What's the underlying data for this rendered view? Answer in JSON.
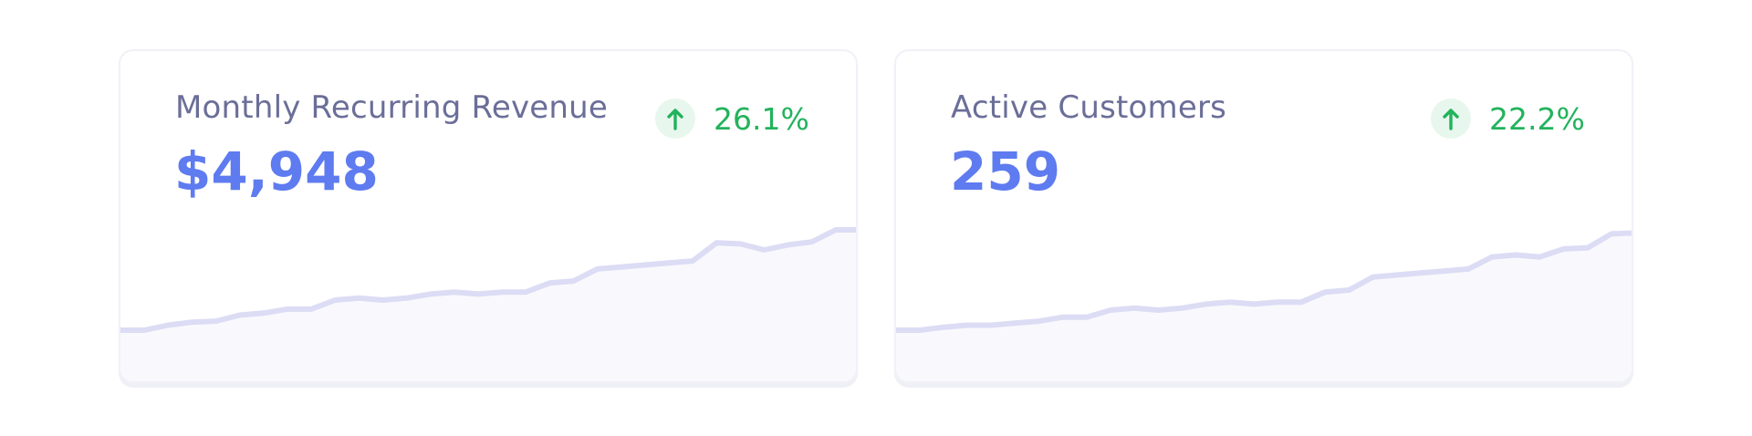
{
  "cards": [
    {
      "title": "Monthly Recurring Revenue",
      "value": "$4,948",
      "change": "26.1%",
      "trend_icon": "arrow-up-icon",
      "spark": [
        0.0,
        0.0,
        0.05,
        0.08,
        0.09,
        0.15,
        0.17,
        0.21,
        0.21,
        0.3,
        0.32,
        0.3,
        0.32,
        0.36,
        0.38,
        0.36,
        0.38,
        0.38,
        0.47,
        0.49,
        0.61,
        0.63,
        0.65,
        0.67,
        0.69,
        0.87,
        0.86,
        0.8,
        0.85,
        0.88,
        1.0,
        1.0
      ]
    },
    {
      "title": "Active Customers",
      "value": "259",
      "change": "22.2%",
      "trend_icon": "arrow-up-icon",
      "spark": [
        0.0,
        0.0,
        0.03,
        0.05,
        0.05,
        0.07,
        0.09,
        0.13,
        0.13,
        0.2,
        0.22,
        0.2,
        0.22,
        0.26,
        0.28,
        0.26,
        0.28,
        0.28,
        0.38,
        0.4,
        0.53,
        0.55,
        0.57,
        0.59,
        0.61,
        0.73,
        0.75,
        0.73,
        0.81,
        0.82,
        0.96,
        0.97
      ]
    }
  ],
  "colors": {
    "title": "#6b6e98",
    "value": "#5e7bf0",
    "positive": "#22b35c",
    "positive_bg": "#e8f7ee",
    "spark_line": "#dcdcf5",
    "spark_fill": "#f9f9fd"
  }
}
